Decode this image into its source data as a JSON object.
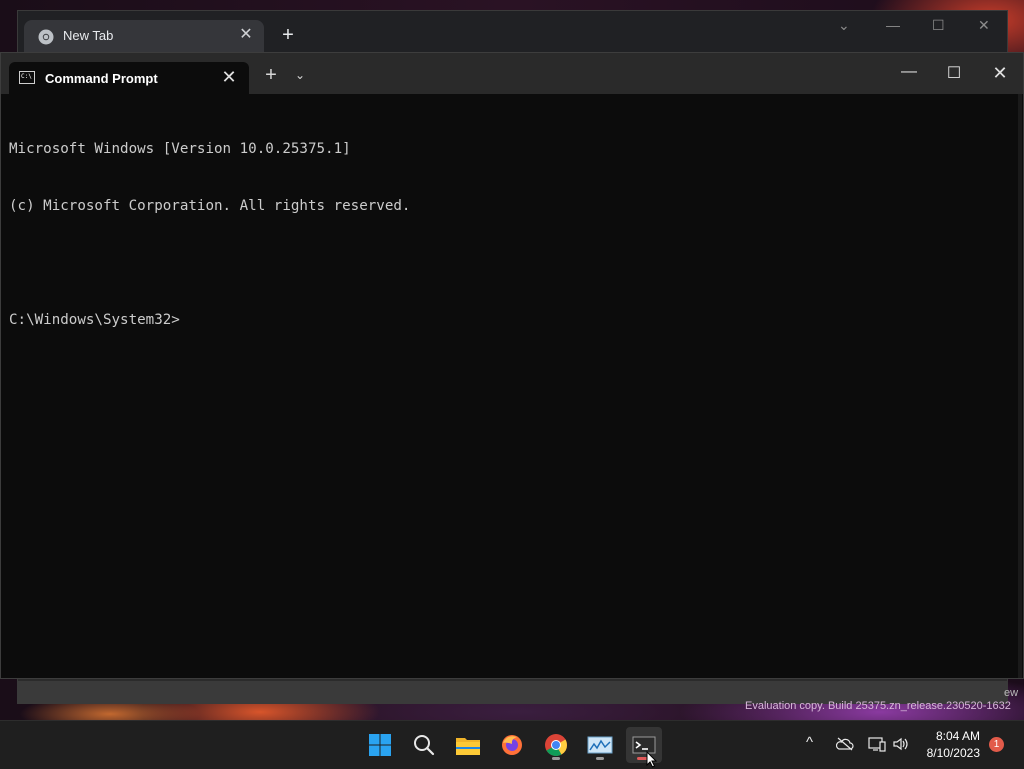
{
  "chrome": {
    "tab_label": "New Tab",
    "new_tab_symbol": "+",
    "close_symbol": "✕",
    "controls": {
      "chevron": "⌄",
      "minimize": "—",
      "maximize": "☐",
      "close": "✕"
    }
  },
  "terminal": {
    "tab_label": "Command Prompt",
    "close_symbol": "✕",
    "add_symbol": "+",
    "dropdown_symbol": "⌄",
    "controls": {
      "minimize": "—",
      "maximize": "☐",
      "close": "✕"
    },
    "lines": [
      "Microsoft Windows [Version 10.0.25375.1]",
      "(c) Microsoft Corporation. All rights reserved.",
      "",
      "C:\\Windows\\System32>"
    ]
  },
  "watermark": {
    "text": "Evaluation copy. Build 25375.zn_release.230520-1632",
    "partial": "ew"
  },
  "taskbar": {
    "apps": [
      {
        "name": "start",
        "icon": "windows-logo-icon"
      },
      {
        "name": "search",
        "icon": "search-icon"
      },
      {
        "name": "file-explorer",
        "icon": "folder-icon"
      },
      {
        "name": "firefox",
        "icon": "firefox-icon"
      },
      {
        "name": "chrome",
        "icon": "chrome-icon",
        "running": true
      },
      {
        "name": "resource-monitor",
        "icon": "monitor-icon",
        "running": true
      },
      {
        "name": "terminal",
        "icon": "terminal-icon",
        "running": true,
        "active": true
      }
    ],
    "tray": {
      "chevron": "^",
      "time": "8:04 AM",
      "date": "8/10/2023",
      "notification_count": "1"
    }
  },
  "colors": {
    "terminal_bg": "#0c0c0c",
    "terminal_text": "#cccccc",
    "taskbar_bg": "#1f1f1f",
    "active_indicator": "#e05a5a"
  }
}
